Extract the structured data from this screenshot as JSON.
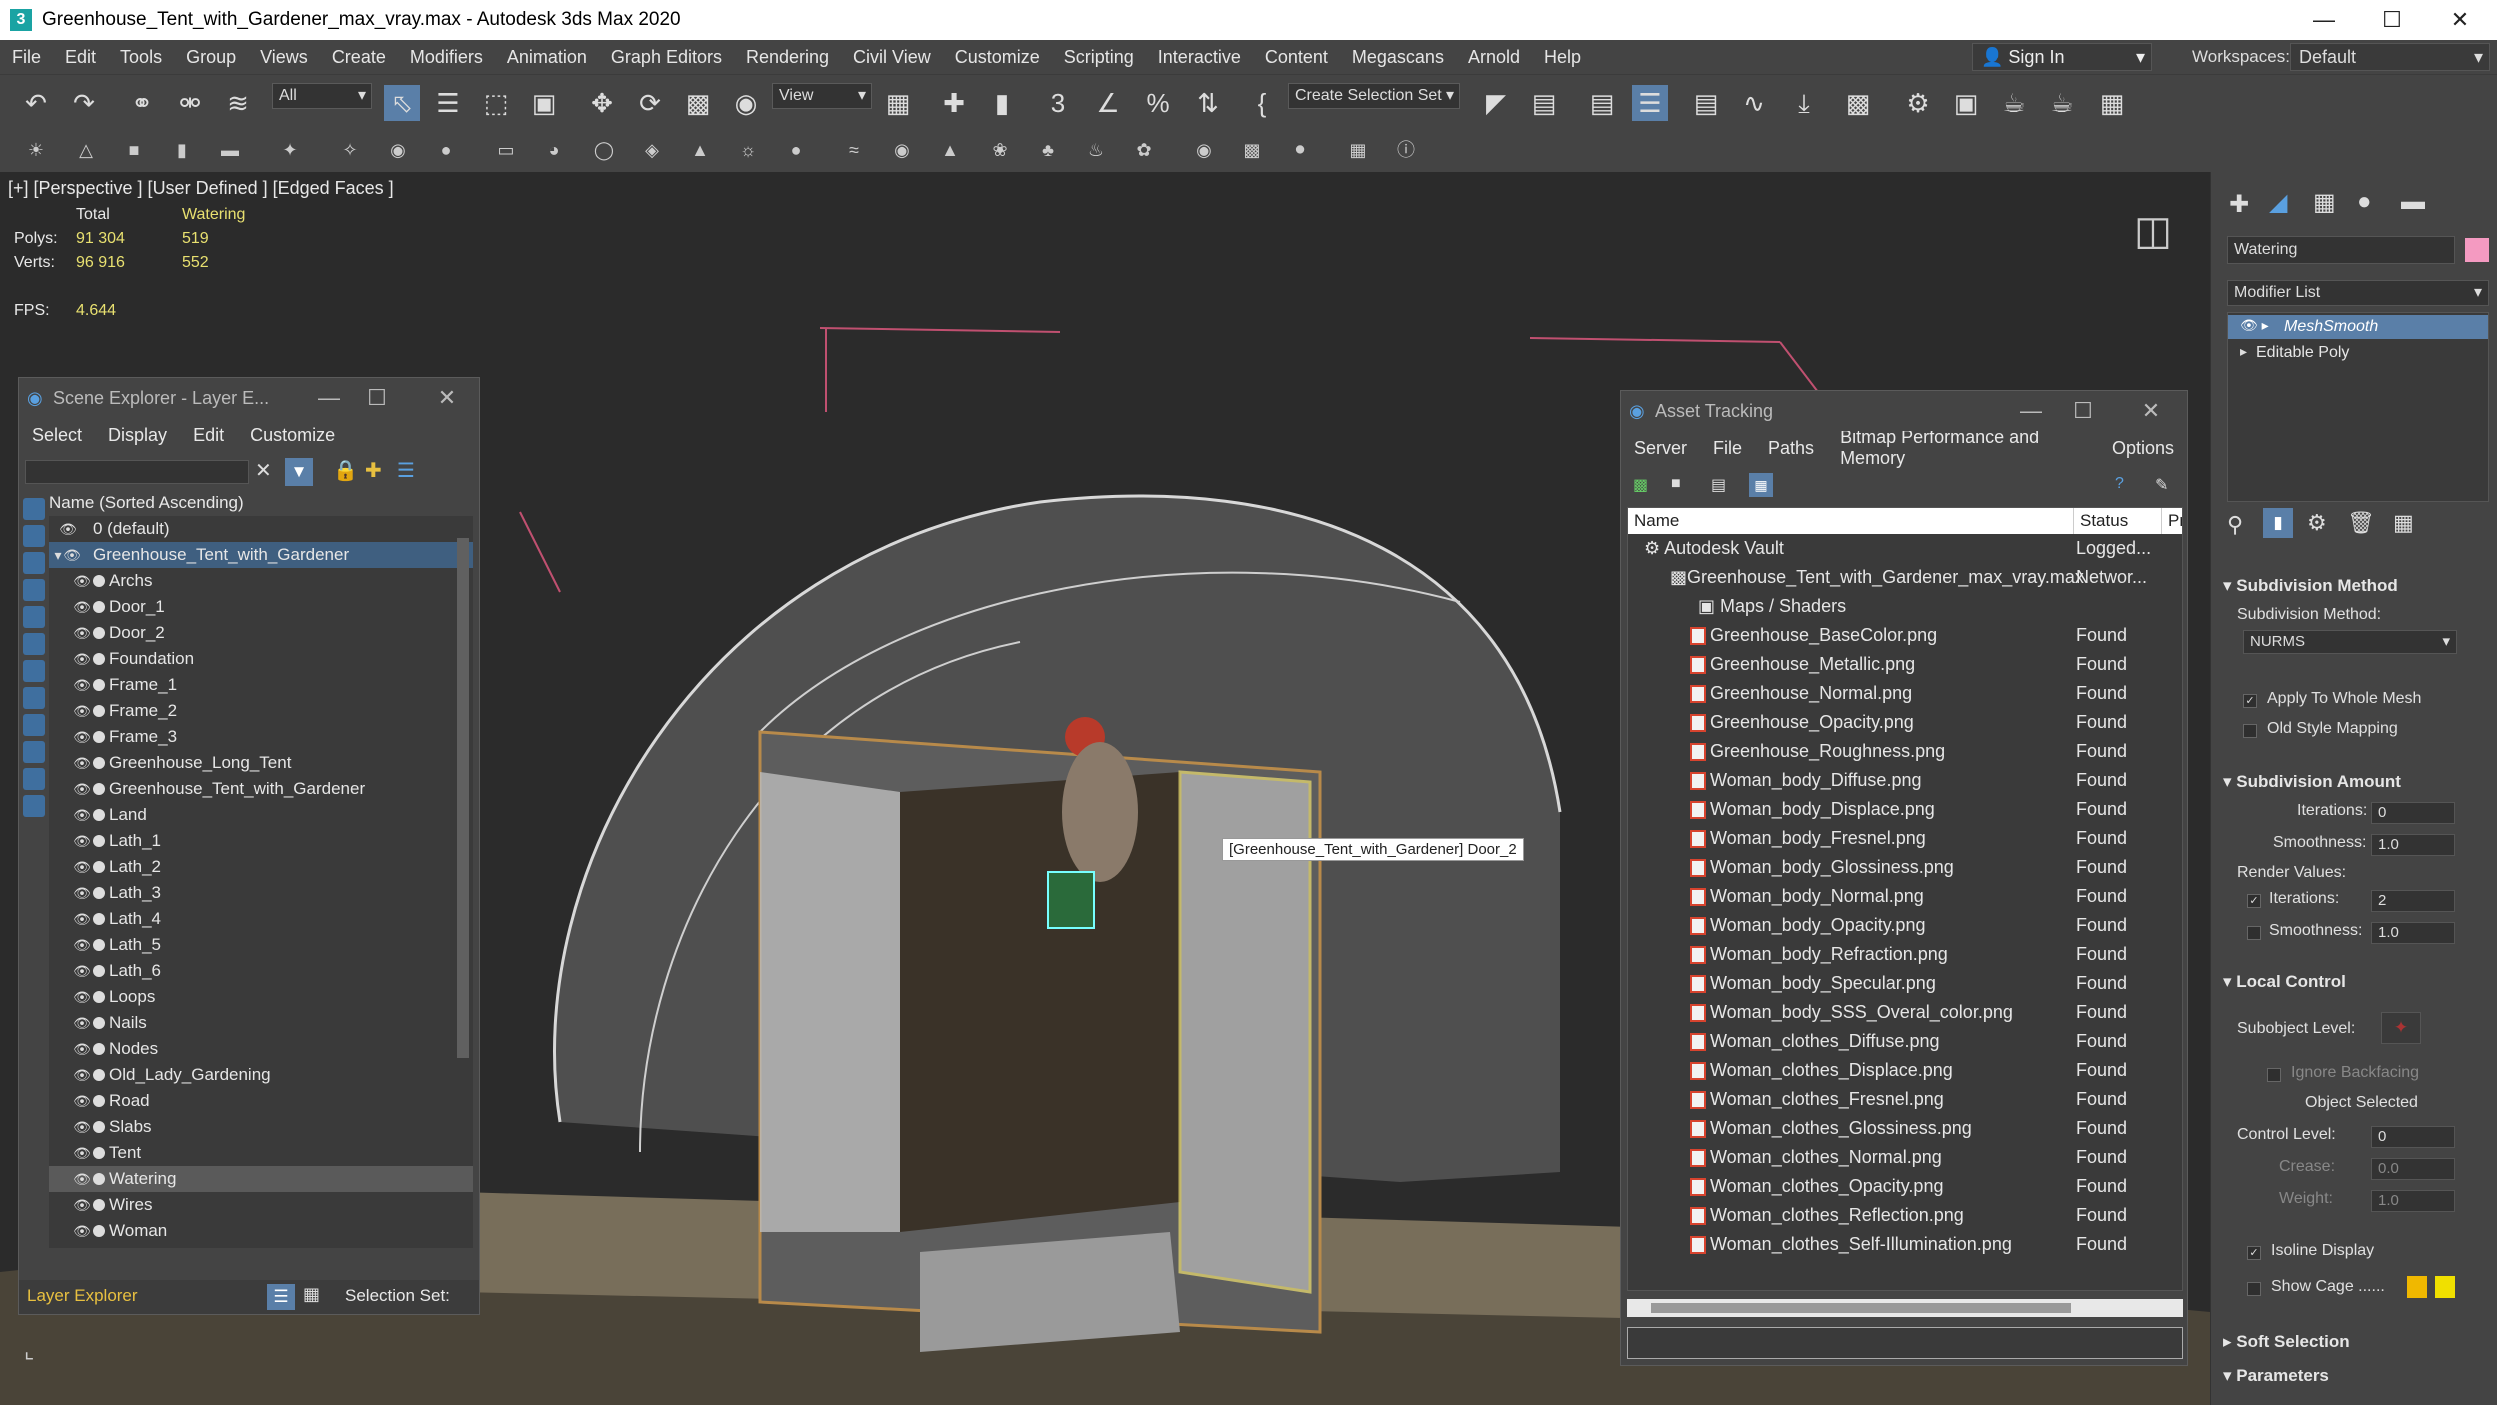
{
  "window": {
    "title": "Greenhouse_Tent_with_Gardener_max_vray.max - Autodesk 3ds Max 2020"
  },
  "menu": [
    "File",
    "Edit",
    "Tools",
    "Group",
    "Views",
    "Create",
    "Modifiers",
    "Animation",
    "Graph Editors",
    "Rendering",
    "Civil View",
    "Customize",
    "Scripting",
    "Interactive",
    "Content",
    "Megascans",
    "Arnold",
    "Help"
  ],
  "account": {
    "sign_in": "Sign In",
    "workspaces_label": "Workspaces:",
    "workspace_value": "Default"
  },
  "toolbar": {
    "filter_value": "All",
    "view_value": "View",
    "selection_set": "Create Selection Set"
  },
  "viewport": {
    "label": "[+] [Perspective ] [User Defined ] [Edged Faces ]",
    "stats": {
      "total_label": "Total",
      "selected_label": "Watering",
      "polys_label": "Polys:",
      "polys_total": "91 304",
      "polys_sel": "519",
      "verts_label": "Verts:",
      "verts_total": "96 916",
      "verts_sel": "552",
      "fps_label": "FPS:",
      "fps_value": "4.644"
    },
    "tooltip": "[Greenhouse_Tent_with_Gardener] Door_2"
  },
  "scene_explorer": {
    "title": "Scene Explorer - Layer E...",
    "menu": [
      "Select",
      "Display",
      "Edit",
      "Customize"
    ],
    "column": "Name (Sorted Ascending)",
    "layers": [
      "0 (default)",
      "Greenhouse_Tent_with_Gardener"
    ],
    "items": [
      "Archs",
      "Door_1",
      "Door_2",
      "Foundation",
      "Frame_1",
      "Frame_2",
      "Frame_3",
      "Greenhouse_Long_Tent",
      "Greenhouse_Tent_with_Gardener",
      "Land",
      "Lath_1",
      "Lath_2",
      "Lath_3",
      "Lath_4",
      "Lath_5",
      "Lath_6",
      "Loops",
      "Nails",
      "Nodes",
      "Old_Lady_Gardening",
      "Road",
      "Slabs",
      "Tent",
      "Watering",
      "Wires",
      "Woman"
    ],
    "selected_item": "Watering",
    "footer_explorer": "Layer Explorer",
    "footer_selset": "Selection Set:"
  },
  "asset_tracking": {
    "title": "Asset Tracking",
    "menu": [
      "Server",
      "File",
      "Paths",
      "Bitmap Performance and Memory",
      "Options"
    ],
    "col_name": "Name",
    "col_status": "Status",
    "col_pr": "Pr",
    "vault": {
      "name": "Autodesk Vault",
      "status": "Logged..."
    },
    "maxfile": {
      "name": "Greenhouse_Tent_with_Gardener_max_vray.max",
      "status": "Networ..."
    },
    "group": "Maps / Shaders",
    "files": [
      {
        "name": "Greenhouse_BaseColor.png",
        "status": "Found"
      },
      {
        "name": "Greenhouse_Metallic.png",
        "status": "Found"
      },
      {
        "name": "Greenhouse_Normal.png",
        "status": "Found"
      },
      {
        "name": "Greenhouse_Opacity.png",
        "status": "Found"
      },
      {
        "name": "Greenhouse_Roughness.png",
        "status": "Found"
      },
      {
        "name": "Woman_body_Diffuse.png",
        "status": "Found"
      },
      {
        "name": "Woman_body_Displace.png",
        "status": "Found"
      },
      {
        "name": "Woman_body_Fresnel.png",
        "status": "Found"
      },
      {
        "name": "Woman_body_Glossiness.png",
        "status": "Found"
      },
      {
        "name": "Woman_body_Normal.png",
        "status": "Found"
      },
      {
        "name": "Woman_body_Opacity.png",
        "status": "Found"
      },
      {
        "name": "Woman_body_Refraction.png",
        "status": "Found"
      },
      {
        "name": "Woman_body_Specular.png",
        "status": "Found"
      },
      {
        "name": "Woman_body_SSS_Overal_color.png",
        "status": "Found"
      },
      {
        "name": "Woman_clothes_Diffuse.png",
        "status": "Found"
      },
      {
        "name": "Woman_clothes_Displace.png",
        "status": "Found"
      },
      {
        "name": "Woman_clothes_Fresnel.png",
        "status": "Found"
      },
      {
        "name": "Woman_clothes_Glossiness.png",
        "status": "Found"
      },
      {
        "name": "Woman_clothes_Normal.png",
        "status": "Found"
      },
      {
        "name": "Woman_clothes_Opacity.png",
        "status": "Found"
      },
      {
        "name": "Woman_clothes_Reflection.png",
        "status": "Found"
      },
      {
        "name": "Woman_clothes_Self-Illumination.png",
        "status": "Found"
      }
    ]
  },
  "command_panel": {
    "object_name": "Watering",
    "object_color": "#f49ac1",
    "modifier_list": "Modifier List",
    "stack": [
      "MeshSmooth",
      "Editable Poly"
    ],
    "subdivision_method": {
      "title": "Subdivision Method",
      "label": "Subdivision Method:",
      "value": "NURMS",
      "apply_whole": "Apply To Whole Mesh",
      "old_style": "Old Style Mapping"
    },
    "subdivision_amount": {
      "title": "Subdivision Amount",
      "iterations_label": "Iterations:",
      "iterations": "0",
      "smoothness_label": "Smoothness:",
      "smoothness": "1.0",
      "render_values": "Render Values:",
      "r_iterations_label": "Iterations:",
      "r_iterations": "2",
      "r_smoothness_label": "Smoothness:",
      "r_smoothness": "1.0"
    },
    "local_control": {
      "title": "Local Control",
      "subobject": "Subobject Level:",
      "ignore_backfacing": "Ignore Backfacing",
      "object_selected": "Object Selected",
      "control_level_label": "Control Level:",
      "control_level": "0",
      "crease_label": "Crease:",
      "crease": "0.0",
      "weight_label": "Weight:",
      "weight": "1.0",
      "isoline": "Isoline Display",
      "show_cage": "Show Cage ......"
    },
    "soft_selection": "Soft Selection",
    "parameters": "Parameters"
  }
}
